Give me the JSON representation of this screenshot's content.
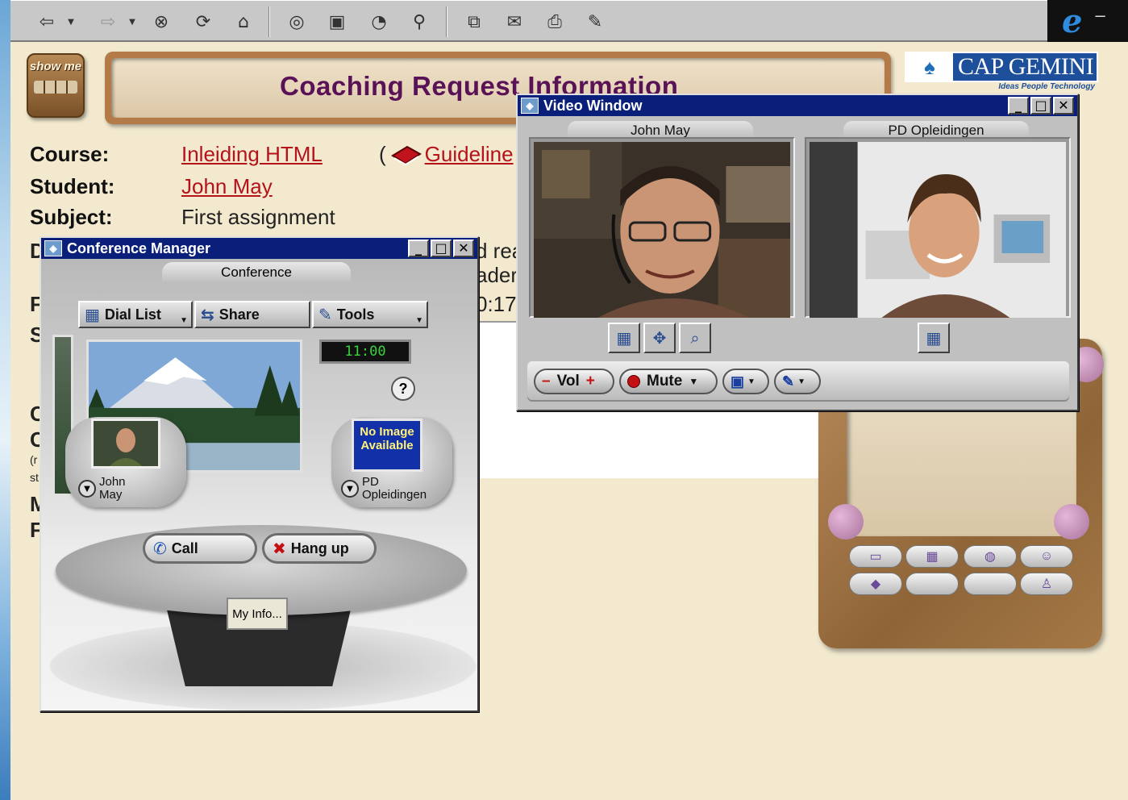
{
  "browser": {
    "toolbar_icons": [
      "back-icon",
      "forward-icon",
      "stop-icon",
      "refresh-icon",
      "home-icon",
      "search-icon",
      "favorites-icon",
      "history-icon",
      "channels-icon",
      "fullscreen-icon",
      "mail-icon",
      "print-icon",
      "edit-icon"
    ],
    "logo": "ie-logo"
  },
  "page": {
    "show_me": "show me",
    "title": "Coaching Request Information",
    "brand": "CAP GEMINI",
    "brand_tagline": "Ideas People Technology",
    "fields": [
      {
        "label": "Course:",
        "value": "Inleiding HTML"
      },
      {
        "label": "Student:",
        "value": "John May"
      },
      {
        "label": "Subject:",
        "value": "First assignment"
      }
    ],
    "guideline_link": "Guideline",
    "guideline_prefix": "(",
    "hidden_fragments": [
      "d rea",
      "ader",
      "0:17"
    ],
    "hidden_labels": [
      "D",
      "F",
      "S",
      "C",
      "C",
      "(r",
      "st",
      "M",
      "F"
    ]
  },
  "video_window": {
    "title": "Video Window",
    "left_pane_label": "John May",
    "right_pane_label": "PD Opleidingen",
    "controls": {
      "vol_minus": "–",
      "vol_label": "Vol",
      "vol_plus": "+",
      "mute_label": "Mute"
    },
    "win_buttons": {
      "min": "_",
      "max": "□",
      "close": "✕"
    }
  },
  "conference_manager": {
    "title": "Conference Manager",
    "tab": "Conference",
    "tools": [
      {
        "label": "Dial List",
        "icon": "dial-list-icon"
      },
      {
        "label": "Share",
        "icon": "share-icon"
      },
      {
        "label": "Tools",
        "icon": "tools-icon"
      }
    ],
    "clock": "11:00",
    "help": "?",
    "participant_left": {
      "line1": "John",
      "line2": "May"
    },
    "participant_right": {
      "line1": "PD",
      "line2": "Opleidingen"
    },
    "no_image": "No Image Available",
    "call": "Call",
    "hang_up": "Hang up",
    "my_info": "My Info...",
    "win_buttons": {
      "min": "_",
      "max": "□",
      "close": "✕"
    }
  },
  "colors": {
    "page_bg": "#f2e9cf",
    "title_purple": "#5a1256",
    "link_red": "#b5121b",
    "titlebar_blue": "#0a1f7a",
    "clock_green": "#3ad33a"
  }
}
